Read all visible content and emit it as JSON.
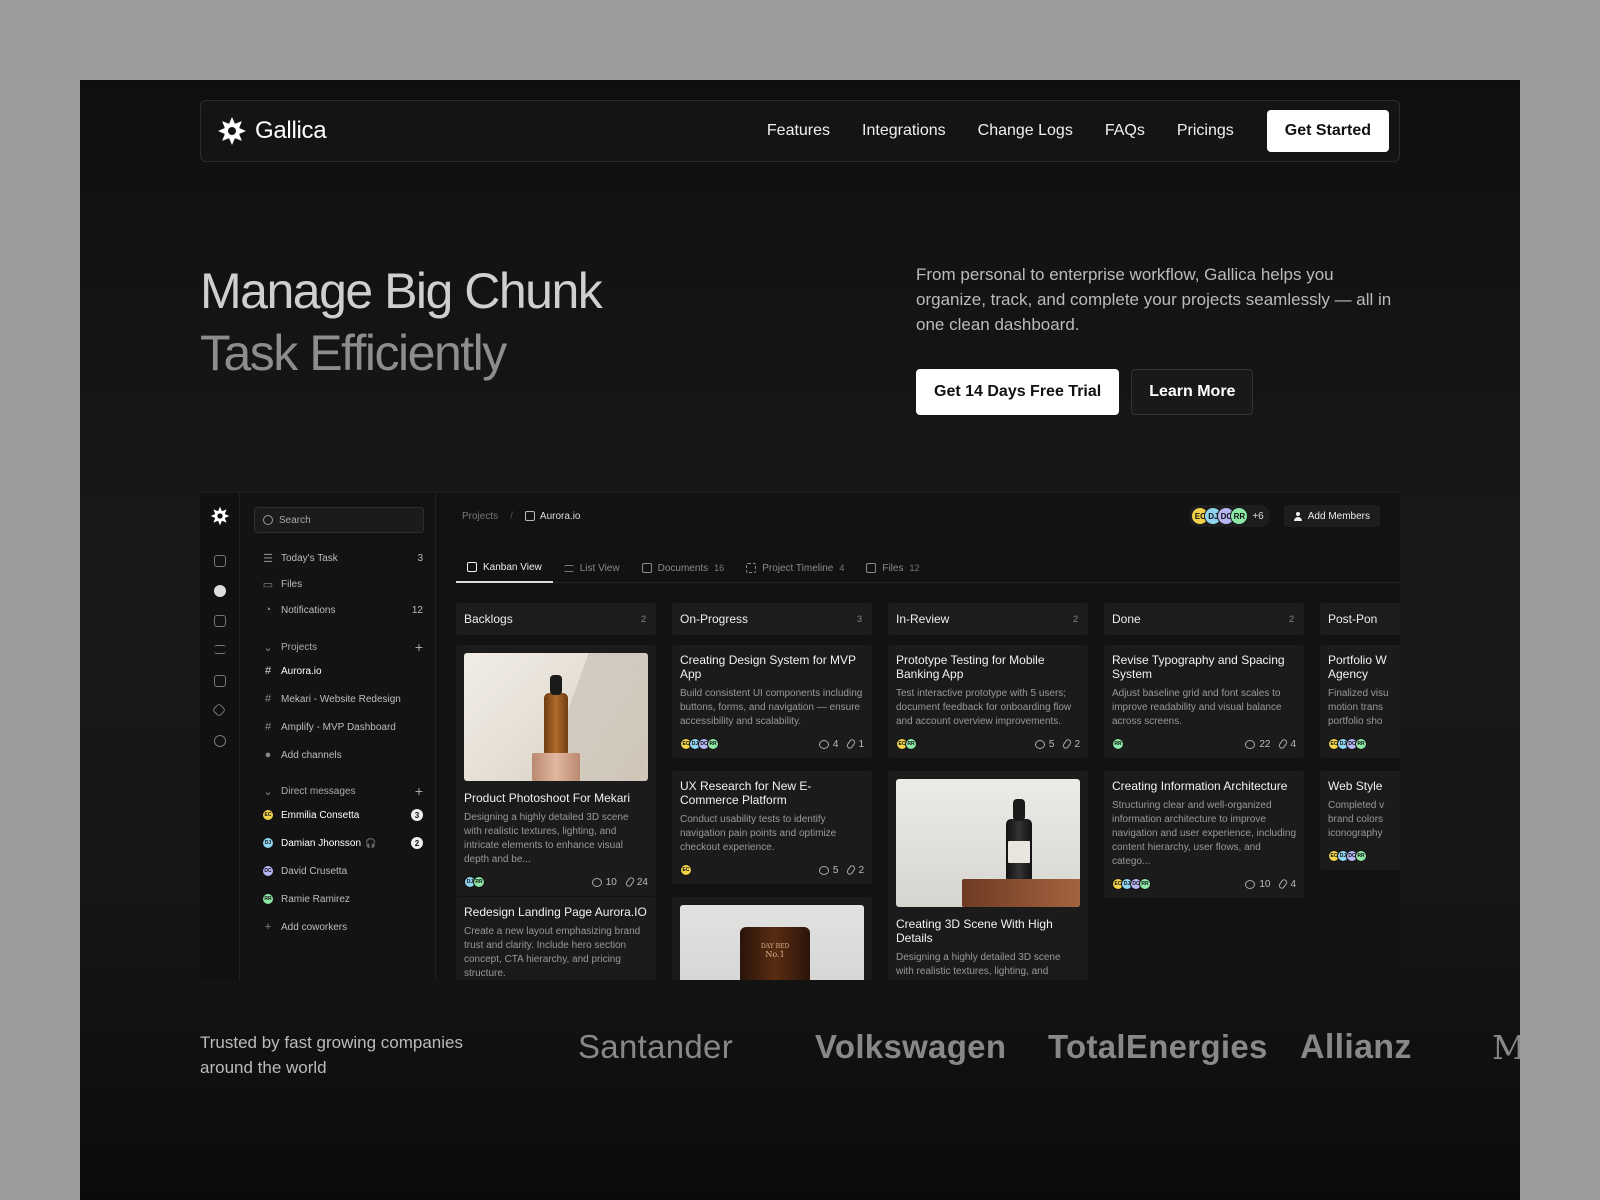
{
  "brand": {
    "name": "Gallica"
  },
  "nav": {
    "links": [
      "Features",
      "Integrations",
      "Change Logs",
      "FAQs",
      "Pricings"
    ],
    "cta": "Get Started"
  },
  "hero": {
    "title_line1": "Manage Big Chunk",
    "title_line2": "Task Efficiently",
    "description": "From personal to enterprise workflow, Gallica helps you organize, track, and complete your projects seamlessly — all in one clean dashboard.",
    "primary_cta": "Get 14 Days Free Trial",
    "secondary_cta": "Learn More"
  },
  "dashboard": {
    "search": {
      "placeholder": "Search"
    },
    "sidebar": {
      "menu": [
        {
          "label": "Today's Task",
          "count": "3",
          "icon": "list-icon"
        },
        {
          "label": "Files",
          "count": "",
          "icon": "folder-icon"
        },
        {
          "label": "Notifications",
          "count": "12",
          "icon": "bell-icon"
        }
      ],
      "projects_heading": "Projects",
      "projects": [
        "Aurora.io",
        "Mekari - Website Redesign",
        "Amplify - MVP Dashboard"
      ],
      "add_channels": "Add channels",
      "dm_heading": "Direct messages",
      "dms": [
        {
          "initials": "EC",
          "name": "Emmilia Consetta",
          "unread": "3",
          "color": "#f2d24a"
        },
        {
          "initials": "DJ",
          "name": "Damian Jhonsson",
          "unread": "2",
          "color": "#8fd4f0"
        },
        {
          "initials": "DC",
          "name": "David Crusetta",
          "unread": "",
          "color": "#b7b6f5"
        },
        {
          "initials": "RR",
          "name": "Ramie Ramirez",
          "unread": "",
          "color": "#8ee8a7"
        }
      ],
      "add_coworkers": "Add coworkers"
    },
    "breadcrumb": {
      "root": "Projects",
      "separator": "/",
      "current": "Aurora.io"
    },
    "members": {
      "initials": [
        "EC",
        "DJ",
        "DC",
        "RR"
      ],
      "more": "+6",
      "add_label": "Add Members"
    },
    "tabs": [
      {
        "label": "Kanban View",
        "count": ""
      },
      {
        "label": "List View",
        "count": ""
      },
      {
        "label": "Documents",
        "count": "16"
      },
      {
        "label": "Project Timeline",
        "count": "4"
      },
      {
        "label": "Files",
        "count": "12"
      }
    ],
    "columns": [
      {
        "title": "Backlogs",
        "count": "2"
      },
      {
        "title": "On-Progress",
        "count": "3"
      },
      {
        "title": "In-Review",
        "count": "2"
      },
      {
        "title": "Done",
        "count": "2"
      },
      {
        "title": "Post-Pon",
        "count": ""
      }
    ],
    "cards": {
      "c1": {
        "title": "Product Photoshoot For Mekari",
        "desc": "Designing a highly detailed 3D scene with realistic textures, lighting, and intricate elements to enhance visual depth and be...",
        "comments": "10",
        "files": "24"
      },
      "c2": {
        "title": "Redesign Landing Page Aurora.IO",
        "desc": "Create a new layout emphasizing brand trust and clarity. Include hero section concept, CTA hierarchy, and pricing structure."
      },
      "c3": {
        "title": "Creating Design System for MVP App",
        "desc": "Build consistent UI components including buttons, forms, and navigation — ensure accessibility and scalability.",
        "comments": "4",
        "files": "1"
      },
      "c4": {
        "title": "UX Research for New E-Commerce Platform",
        "desc": "Conduct usability tests to identify navigation pain points and optimize checkout experience.",
        "comments": "5",
        "files": "2"
      },
      "c5": {
        "title": "Prototype Testing for Mobile Banking App",
        "desc": "Test interactive prototype with 5 users; document feedback for onboarding flow and account overview improvements.",
        "comments": "5",
        "files": "2"
      },
      "c6": {
        "title": "Creating 3D Scene With High Details",
        "desc": "Designing a highly detailed 3D scene with realistic textures, lighting, and intricate"
      },
      "c7": {
        "title": "Revise Typography and Spacing System",
        "desc": "Adjust baseline grid and font scales to improve readability and visual balance across screens.",
        "comments": "22",
        "files": "4"
      },
      "c8": {
        "title": "Creating Information Architecture",
        "desc": "Structuring clear and well-organized information architecture to improve navigation and user experience, including content hierarchy, user flows, and catego...",
        "comments": "10",
        "files": "4"
      },
      "c9": {
        "title": "Portfolio W Agency",
        "desc": "Finalized visu motion trans portfolio sho"
      },
      "c10": {
        "title": "Web Style",
        "desc": "Completed v brand colors iconography"
      }
    },
    "bottle_labels": {
      "jar_line1": "DAY BED",
      "jar_line2": "No.1"
    }
  },
  "trusted": {
    "text": "Trusted by fast growing companies around the world",
    "logos": [
      "Santander",
      "Volkswagen",
      "TotalEnergies",
      "Allianz",
      "Mc"
    ]
  },
  "colors": {
    "avatar_ec": "#f2d24a",
    "avatar_dj": "#8fd4f0",
    "avatar_dc": "#b7b6f5",
    "avatar_rr": "#8ee8a7"
  }
}
